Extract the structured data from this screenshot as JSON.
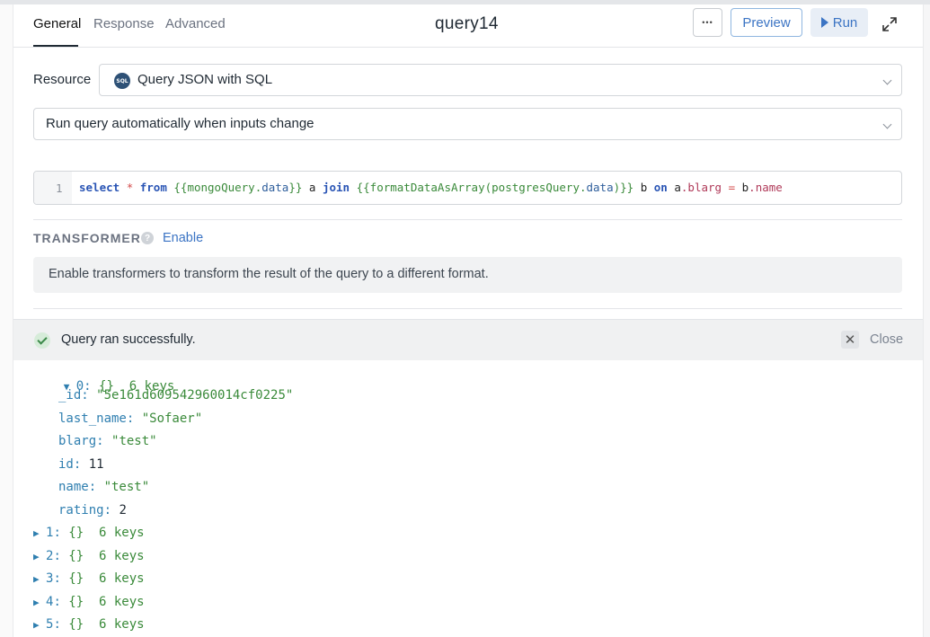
{
  "header": {
    "tabs": [
      {
        "label": "General",
        "active": true
      },
      {
        "label": "Response",
        "active": false
      },
      {
        "label": "Advanced",
        "active": false
      }
    ],
    "title": "query14",
    "more_label": "•••",
    "preview_label": "Preview",
    "run_label": "Run"
  },
  "form": {
    "resource_label": "Resource",
    "resource_badge": "SQL",
    "resource_value": "Query JSON with SQL",
    "run_mode_value": "Run query automatically when inputs change"
  },
  "editor": {
    "line_number": "1",
    "tokens": [
      {
        "t": "select",
        "c": "kw"
      },
      {
        "t": " ",
        "c": ""
      },
      {
        "t": "*",
        "c": "op"
      },
      {
        "t": " ",
        "c": ""
      },
      {
        "t": "from",
        "c": "kw"
      },
      {
        "t": " ",
        "c": ""
      },
      {
        "t": "{{mongoQuery.",
        "c": "tmpl"
      },
      {
        "t": "data",
        "c": "prop2"
      },
      {
        "t": "}}",
        "c": "tmpl"
      },
      {
        "t": " a ",
        "c": ""
      },
      {
        "t": "join",
        "c": "kw"
      },
      {
        "t": " ",
        "c": ""
      },
      {
        "t": "{{formatDataAsArray(postgresQuery.",
        "c": "tmpl"
      },
      {
        "t": "data",
        "c": "prop2"
      },
      {
        "t": ")}}",
        "c": "tmpl"
      },
      {
        "t": " b ",
        "c": ""
      },
      {
        "t": "on",
        "c": "kw"
      },
      {
        "t": " a",
        "c": ""
      },
      {
        "t": ".blarg",
        "c": "prop"
      },
      {
        "t": " ",
        "c": ""
      },
      {
        "t": "=",
        "c": "op"
      },
      {
        "t": " b",
        "c": ""
      },
      {
        "t": ".name",
        "c": "prop"
      }
    ]
  },
  "transformer": {
    "label": "TRANSFORMER",
    "help_glyph": "?",
    "enable_label": "Enable",
    "info": "Enable transformers to transform the result of the query to a different format."
  },
  "results": {
    "status": "Query ran successfully.",
    "close_glyph": "✕",
    "close_label": "Close",
    "expanded_item": {
      "index": "0",
      "summary": "{}  6 keys",
      "fields": [
        {
          "key": "_id",
          "value": "\"5e161d609542960014cf0225\"",
          "type": "string"
        },
        {
          "key": "last_name",
          "value": "\"Sofaer\"",
          "type": "string"
        },
        {
          "key": "blarg",
          "value": "\"test\"",
          "type": "string"
        },
        {
          "key": "id",
          "value": "11",
          "type": "number"
        },
        {
          "key": "name",
          "value": "\"test\"",
          "type": "string"
        },
        {
          "key": "rating",
          "value": "2",
          "type": "number"
        }
      ]
    },
    "collapsed_items": [
      {
        "index": "1",
        "summary": "{}  6 keys"
      },
      {
        "index": "2",
        "summary": "{}  6 keys"
      },
      {
        "index": "3",
        "summary": "{}  6 keys"
      },
      {
        "index": "4",
        "summary": "{}  6 keys"
      },
      {
        "index": "5",
        "summary": "{}  6 keys"
      }
    ],
    "expanded_arrow": "▼",
    "collapsed_arrow": "▶"
  },
  "colors": {
    "accent": "#3b74c4",
    "success": "#3c8a4a",
    "json_key": "#2f7fb0",
    "json_string": "#3a8a3a"
  }
}
